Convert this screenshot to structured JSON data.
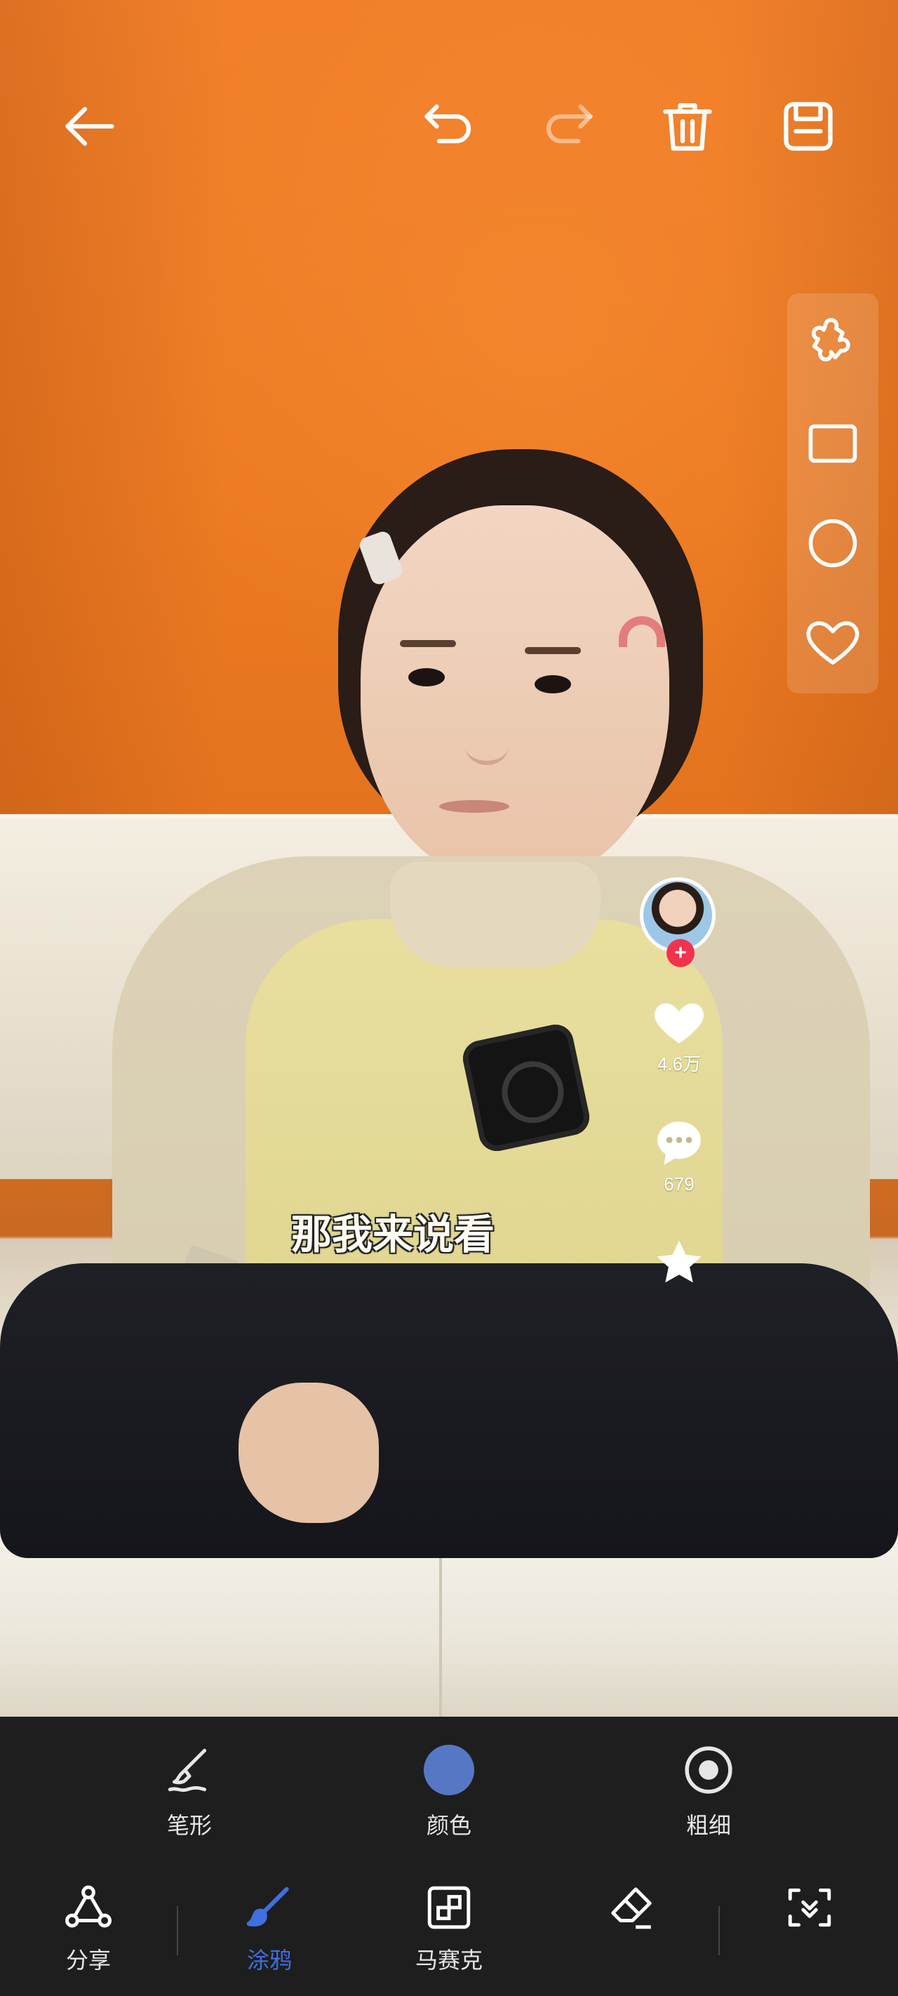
{
  "top_toolbar": {
    "back_icon": "arrow-left-icon",
    "undo_icon": "undo-icon",
    "redo_icon": "redo-icon",
    "redo_enabled": false,
    "delete_icon": "trash-icon",
    "save_icon": "save-icon"
  },
  "shape_panel": {
    "items": [
      "puzzle-shape",
      "rectangle-shape",
      "circle-shape",
      "heart-shape"
    ]
  },
  "video_overlay": {
    "like_count": "4.6万",
    "comment_count": "679",
    "follow_symbol": "+",
    "subtitle": "那我来说看"
  },
  "brush_options": {
    "shape_label": "笔形",
    "color_label": "颜色",
    "size_label": "粗细",
    "current_color": "#5677c4"
  },
  "modes": {
    "share_label": "分享",
    "doodle_label": "涂鸦",
    "mosaic_label": "马赛克",
    "active": "doodle"
  },
  "colors": {
    "accent": "#3f6fe0",
    "panel_bg": "#1e1e1e",
    "icon_fg": "#ffffff"
  }
}
